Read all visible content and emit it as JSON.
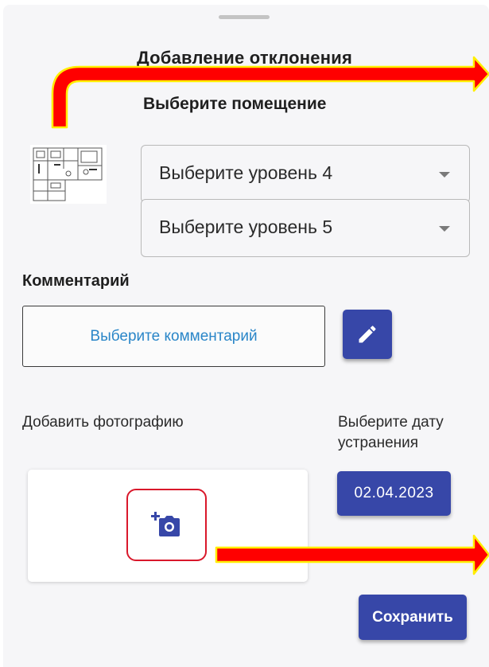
{
  "header": {
    "title": "Добавление отклонения",
    "room_label": "Выберите помещение"
  },
  "room_selects": [
    {
      "value": "Выберите уровень 4"
    },
    {
      "value": "Выберите уровень 5"
    }
  ],
  "comment": {
    "label": "Комментарий",
    "placeholder": "Выберите комментарий",
    "edit_icon": "pencil-icon"
  },
  "photo": {
    "label": "Добавить фотографию",
    "icon": "add-photo-icon"
  },
  "date": {
    "label": "Выберите дату устранения",
    "value": "02.04.2023"
  },
  "actions": {
    "save_label": "Сохранить"
  },
  "colors": {
    "primary": "#3747a8",
    "link": "#2a86c8",
    "annotation_arrow": "#ff0000",
    "annotation_outline": "#ffee00",
    "highlight": "#d9182b"
  }
}
